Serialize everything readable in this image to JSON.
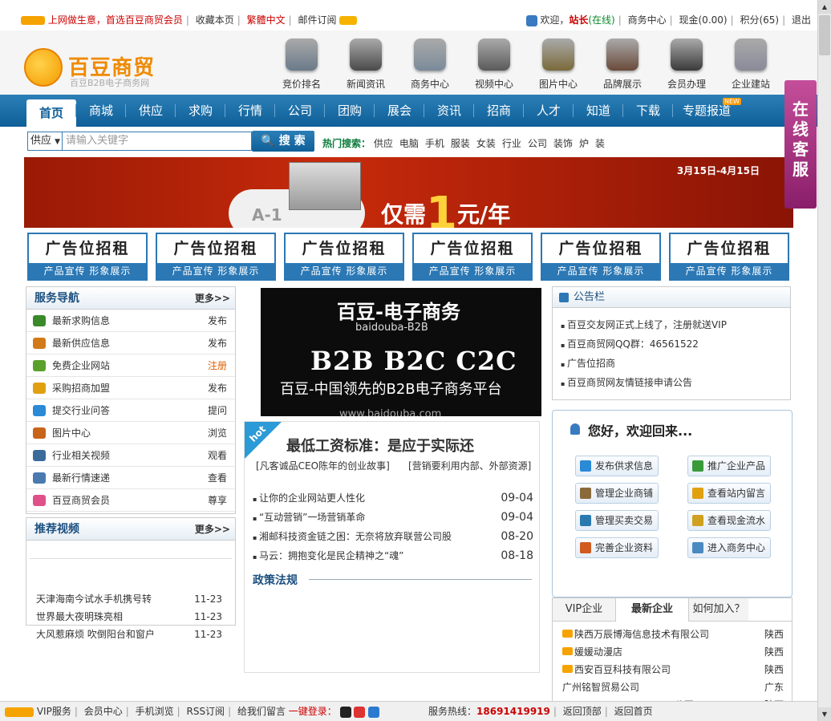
{
  "topbar": {
    "slogan": "上网做生意，首选百豆商贸会员",
    "bookmark": "收藏本页",
    "traditional": "繁體中文",
    "mail_sub": "邮件订阅",
    "welcome": "欢迎，",
    "username": "站长",
    "online": "(在线)",
    "biz_center": "商务中心",
    "cash": "现金(0.00)",
    "points": "积分(65)",
    "logout": "退出"
  },
  "logo": {
    "title": "百豆商贸",
    "subtitle": "百豆B2B电子商务网"
  },
  "header_icons": [
    "竞价排名",
    "新闻资讯",
    "商务中心",
    "视频中心",
    "图片中心",
    "品牌展示",
    "会员办理",
    "企业建站"
  ],
  "nav": [
    "首页",
    "商城",
    "供应",
    "求购",
    "行情",
    "公司",
    "团购",
    "展会",
    "资讯",
    "招商",
    "人才",
    "知道",
    "下载",
    "专题报道"
  ],
  "nav_new": "NEW",
  "search": {
    "select": "供应",
    "placeholder": "请输入关键字",
    "button": "搜 索",
    "hot_label": "热门搜索：",
    "hot": [
      "供应",
      "电脑",
      "手机",
      "服装",
      "女装",
      "行业",
      "公司",
      "装饰",
      "炉",
      "装"
    ]
  },
  "banner": {
    "date": "3月15日-4月15日",
    "prefix": "仅需",
    "num": "1",
    "suffix": "元/年",
    "tag": "A-1"
  },
  "ads": {
    "title": "广告位招租",
    "sub": "产品宣传 形象展示"
  },
  "service": {
    "title": "服务导航",
    "more": "更多>>",
    "items": [
      {
        "label": "最新求购信息",
        "action": "发布",
        "color": "#3a8a2a"
      },
      {
        "label": "最新供应信息",
        "action": "发布",
        "color": "#d27a1a"
      },
      {
        "label": "免费企业网站",
        "action": "注册",
        "color": "#5aa02a"
      },
      {
        "label": "采购招商加盟",
        "action": "发布",
        "color": "#e0a010"
      },
      {
        "label": "提交行业问答",
        "action": "提问",
        "color": "#2a8ad6"
      },
      {
        "label": "图片中心",
        "action": "浏览",
        "color": "#c8641a"
      },
      {
        "label": "行业相关视频",
        "action": "观看",
        "color": "#3b6b9b"
      },
      {
        "label": "最新行情速递",
        "action": "查看",
        "color": "#4a7ab0"
      },
      {
        "label": "百豆商贸会员",
        "action": "尊享",
        "color": "#e0508a"
      }
    ]
  },
  "video": {
    "title": "推荐视频",
    "more": "更多>>",
    "items": [
      {
        "title": "天津海南今试水手机携号转",
        "date": "11-23"
      },
      {
        "title": "世界最大夜明珠亮相",
        "date": "11-23"
      },
      {
        "title": "大风惹麻烦 吹倒阳台和窗户",
        "date": "11-23"
      }
    ]
  },
  "promo": {
    "l1": "百豆-电子商务",
    "l2": "baidouba-B2B",
    "l3": "B2B B2C C2C",
    "l4": "百豆-中国领先的B2B电子商务平台",
    "l5": "www.baidouba.com"
  },
  "news": {
    "hot": "hot",
    "headline": "最低工资标准：是应于实际还",
    "sub1": "[凡客诚品CEO陈年的创业故事]",
    "sub2": "[营销要利用内部、外部资源]",
    "items": [
      {
        "title": "让你的企业网站更人性化",
        "date": "09-04"
      },
      {
        "title": "“互动营销”一场营销革命",
        "date": "09-04"
      },
      {
        "title": "湘邮科技资金链之困：无奈将放弃联营公司股",
        "date": "08-20"
      },
      {
        "title": "马云：拥抱变化是民企精神之“魂”",
        "date": "08-18"
      }
    ],
    "policy": "政策法规"
  },
  "notice": {
    "title": "公告栏",
    "items": [
      "百豆交友网正式上线了，注册就送VIP",
      "百豆商贸网QQ群：46561522",
      "广告位招商",
      "百豆商贸网友情链接申请公告"
    ]
  },
  "welcome": {
    "title": "您好，欢迎回来...",
    "buttons": [
      {
        "label": "发布供求信息",
        "color": "#2a8ad6"
      },
      {
        "label": "推广企业产品",
        "color": "#3a9a3a"
      },
      {
        "label": "管理企业商铺",
        "color": "#8a6a3a"
      },
      {
        "label": "查看站内留言",
        "color": "#e0a010"
      },
      {
        "label": "管理买卖交易",
        "color": "#2a7ab0"
      },
      {
        "label": "查看现金流水",
        "color": "#d0a020"
      },
      {
        "label": "完善企业资料",
        "color": "#d05a20"
      },
      {
        "label": "进入商务中心",
        "color": "#4a8ac0"
      }
    ]
  },
  "companies": {
    "tabs": [
      "VIP企业",
      "最新企业",
      "如何加入？"
    ],
    "items": [
      {
        "name": "陕西万辰博海信息技术有限公司",
        "prov": "陕西",
        "gem": true
      },
      {
        "name": "媛媛动漫店",
        "prov": "陕西",
        "gem": true
      },
      {
        "name": "西安百豆科技有限公司",
        "prov": "陕西",
        "gem": true
      },
      {
        "name": "广州铭智贸易公司",
        "prov": "广东",
        "gem": false
      },
      {
        "name": "公司",
        "prov": "陕西",
        "gem": false
      }
    ]
  },
  "side_service": "在线客服",
  "footer": {
    "vip": "VIP服务",
    "member": "会员中心",
    "mobile": "手机浏览",
    "rss": "RSS订阅",
    "message": "给我们留言",
    "login": "一键登录：",
    "hotline_label": "服务热线：",
    "hotline": "18691419919",
    "top": "返回顶部",
    "home": "返回首页"
  },
  "colors": {
    "brand_blue": "#1a6aa5",
    "brand_orange": "#f08a00",
    "red": "#cc0000"
  }
}
